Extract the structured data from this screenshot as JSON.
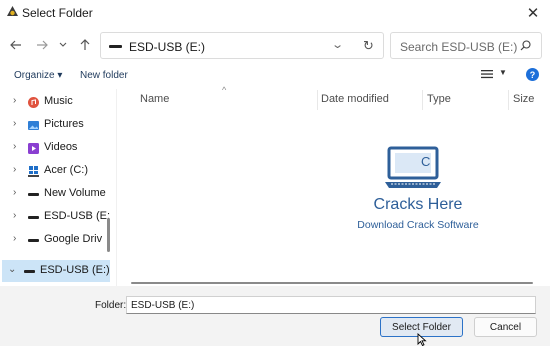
{
  "window": {
    "title": "Select Folder",
    "close_glyph": "✕"
  },
  "nav": {
    "address": "ESD-USB (E:)",
    "search_placeholder": "Search ESD-USB (E:)"
  },
  "command_bar": {
    "organize_label": "Organize ▾",
    "new_folder_label": "New folder",
    "help_glyph": "?"
  },
  "tree": {
    "items": [
      {
        "label": "Music",
        "icon": "music-icon",
        "color": "#e0533e"
      },
      {
        "label": "Pictures",
        "icon": "pictures-icon",
        "color": "#2f7fd6"
      },
      {
        "label": "Videos",
        "icon": "videos-icon",
        "color": "#8a3fd1"
      },
      {
        "label": "Acer (C:)",
        "icon": "windows-drive-icon",
        "color": "#1f6fc8"
      },
      {
        "label": "New Volume",
        "icon": "drive-icon",
        "color": "#222222"
      },
      {
        "label": "ESD-USB (E:",
        "icon": "drive-icon",
        "color": "#222222"
      },
      {
        "label": "Google Driv",
        "icon": "drive-icon",
        "color": "#222222"
      },
      {
        "label": "ESD-USB (E:)",
        "icon": "drive-icon",
        "color": "#222222",
        "selected": true
      }
    ]
  },
  "file_list": {
    "columns": [
      "Name",
      "Date modified",
      "Type",
      "Size"
    ]
  },
  "watermark": {
    "title": "Cracks Here",
    "subtitle": "Download Crack Software",
    "icon_glyph": "C",
    "color": "#2e5f99"
  },
  "footer": {
    "folder_label": "Folder:",
    "folder_value": "ESD-USB (E:)",
    "select_button": "Select Folder",
    "cancel_button": "Cancel"
  }
}
